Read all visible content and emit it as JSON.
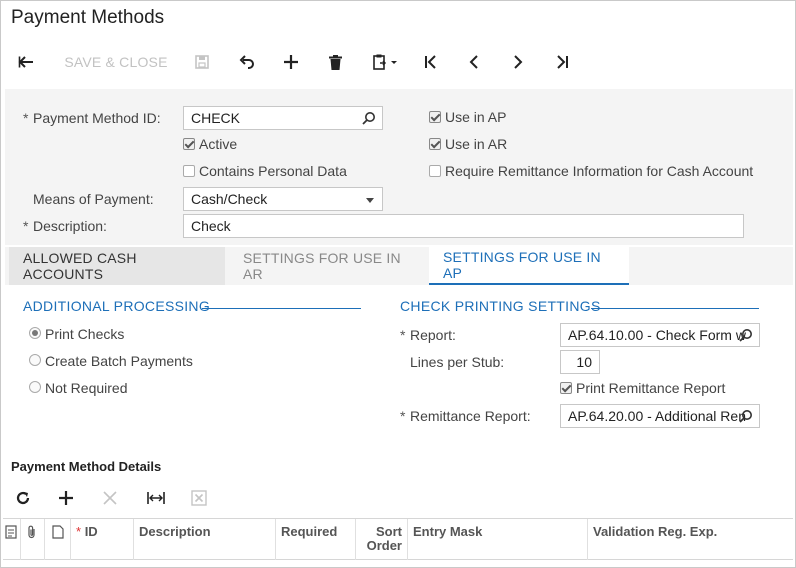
{
  "title": "Payment Methods",
  "toolbar": {
    "back_icon": "arrow-back-icon",
    "save_close_label": "SAVE & CLOSE",
    "save_icon": "floppy-icon",
    "undo_icon": "undo-icon",
    "add_icon": "plus-icon",
    "delete_icon": "trash-icon",
    "clipboard_icon": "clipboard-icon",
    "first_icon": "first-icon",
    "prev_icon": "prev-icon",
    "next_icon": "next-icon",
    "last_icon": "last-icon"
  },
  "form": {
    "payment_method_id_label": "Payment Method ID:",
    "payment_method_id_value": "CHECK",
    "active_label": "Active",
    "active_checked": true,
    "contains_personal_label": "Contains Personal Data",
    "contains_personal_checked": false,
    "means_label": "Means of Payment:",
    "means_value": "Cash/Check",
    "description_label": "Description:",
    "description_value": "Check",
    "use_in_ap_label": "Use in AP",
    "use_in_ap_checked": true,
    "use_in_ar_label": "Use in AR",
    "use_in_ar_checked": true,
    "require_remit_label": "Require Remittance Information for Cash Account",
    "require_remit_checked": false,
    "required_marker": "*"
  },
  "tabs": [
    {
      "label": "ALLOWED CASH ACCOUNTS"
    },
    {
      "label": "SETTINGS FOR USE IN AR"
    },
    {
      "label": "SETTINGS FOR USE IN AP"
    }
  ],
  "additional_processing": {
    "title": "ADDITIONAL PROCESSING",
    "options": [
      {
        "label": "Print Checks",
        "selected": true
      },
      {
        "label": "Create Batch Payments",
        "selected": false
      },
      {
        "label": "Not Required",
        "selected": false
      }
    ]
  },
  "check_printing": {
    "title": "CHECK PRINTING SETTINGS",
    "report_label": "Report:",
    "report_value": "AP.64.10.00 - Check Form w",
    "lines_label": "Lines per Stub:",
    "lines_value": "10",
    "print_remit_label": "Print Remittance Report",
    "print_remit_checked": true,
    "remit_report_label": "Remittance Report:",
    "remit_report_value": "AP.64.20.00 - Additional Ren"
  },
  "details": {
    "title": "Payment Method Details",
    "columns": {
      "id": "ID",
      "description": "Description",
      "required": "Required",
      "sort_order": "Sort Order",
      "entry_mask": "Entry Mask",
      "validation": "Validation Reg. Exp."
    }
  }
}
